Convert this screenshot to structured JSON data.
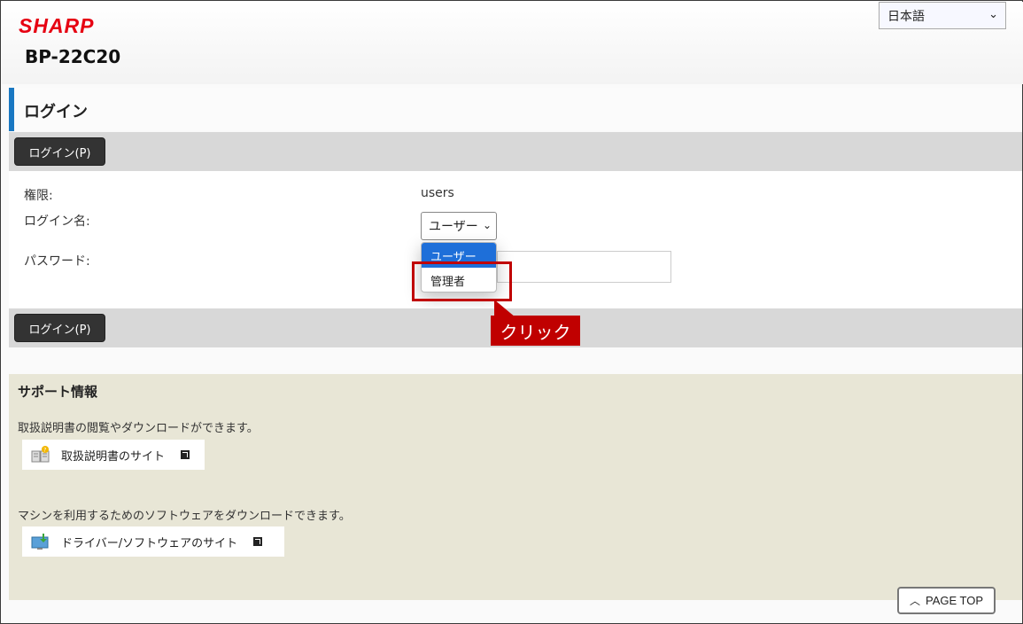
{
  "header": {
    "brand": "SHARP",
    "model": "BP-22C20",
    "language": "日本語"
  },
  "page": {
    "title": "ログイン",
    "login_button_label": "ログイン(P)"
  },
  "form": {
    "authority_label": "権限:",
    "authority_value": "users",
    "login_name_label": "ログイン名:",
    "login_name_value": "ユーザー",
    "password_label": "パスワード:",
    "dropdown_options": [
      "ユーザー",
      "管理者"
    ]
  },
  "annotation": {
    "callout_text": "クリック",
    "highlight_color": "#c00000"
  },
  "support": {
    "title": "サポート情報",
    "manual_text": "取扱説明書の閲覧やダウンロードができます。",
    "manual_link": "取扱説明書のサイト",
    "software_text": "マシンを利用するためのソフトウェアをダウンロードできます。",
    "software_link": "ドライバー/ソフトウェアのサイト"
  },
  "page_top_label": "PAGE TOP",
  "colors": {
    "brand_red": "#e60012",
    "title_accent": "#1a78c2",
    "button_dark": "#333333",
    "support_bg": "#e8e6d6",
    "selected_option": "#1e6fd9"
  }
}
